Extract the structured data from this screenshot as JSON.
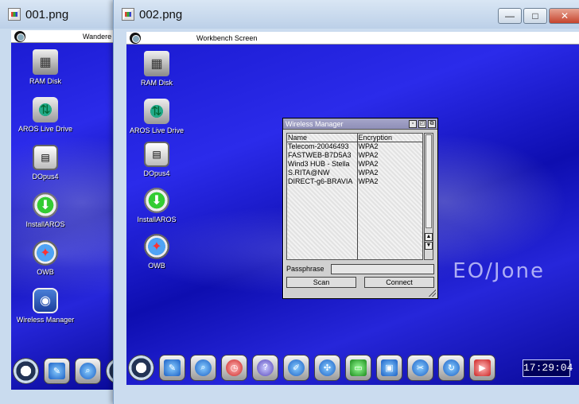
{
  "windows": {
    "back": {
      "title": "001.png",
      "screen_title": "Wandere",
      "icons": [
        "RAM Disk",
        "AROS Live Drive",
        "DOpus4",
        "InstallAROS",
        "OWB",
        "Wireless Manager"
      ]
    },
    "front": {
      "title": "002.png",
      "controls": [
        "—",
        "□",
        "✕"
      ],
      "screen_title": "Workbench Screen",
      "icons": [
        "RAM Disk",
        "AROS Live Drive",
        "DOpus4",
        "InstallAROS",
        "OWB"
      ],
      "watermark": " EO∕Jone",
      "clock": "17:29:04"
    }
  },
  "icon_names": [
    "ram-disk-icon",
    "usb-drive-icon",
    "dopus-icon",
    "install-aros-icon",
    "owb-browser-icon",
    "wireless-icon"
  ],
  "dock": {
    "front_icons": [
      "aros-logo-icon",
      "shell-icon",
      "search-icon",
      "clock-icon",
      "help-icon",
      "editor-icon",
      "network-icon",
      "monitor-icon",
      "screens-icon",
      "scissors-icon",
      "refresh-icon",
      "youtube-icon"
    ],
    "back_icons": [
      "aros-logo-icon",
      "shell-icon",
      "search-icon",
      "aros-logo-icon"
    ]
  },
  "wireless_manager": {
    "title": "Wireless Manager",
    "columns": [
      "Name",
      "Encryption"
    ],
    "networks": [
      {
        "name": "Telecom-20046493",
        "encryption": "WPA2"
      },
      {
        "name": "FASTWEB-B7D5A3",
        "encryption": "WPA2"
      },
      {
        "name": "Wind3 HUB - Stella",
        "encryption": "WPA2"
      },
      {
        "name": "S.RITA@NW",
        "encryption": "WPA2"
      },
      {
        "name": "DIRECT-g6-BRAVIA",
        "encryption": "WPA2"
      }
    ],
    "passphrase_label": "Passphrase",
    "passphrase_value": "",
    "scan_label": "Scan",
    "connect_label": "Connect"
  },
  "colors": {
    "desktop_blue": "#1a1ad0",
    "wm_title": "#a6a6c9",
    "clock_bg": "#00005a"
  }
}
